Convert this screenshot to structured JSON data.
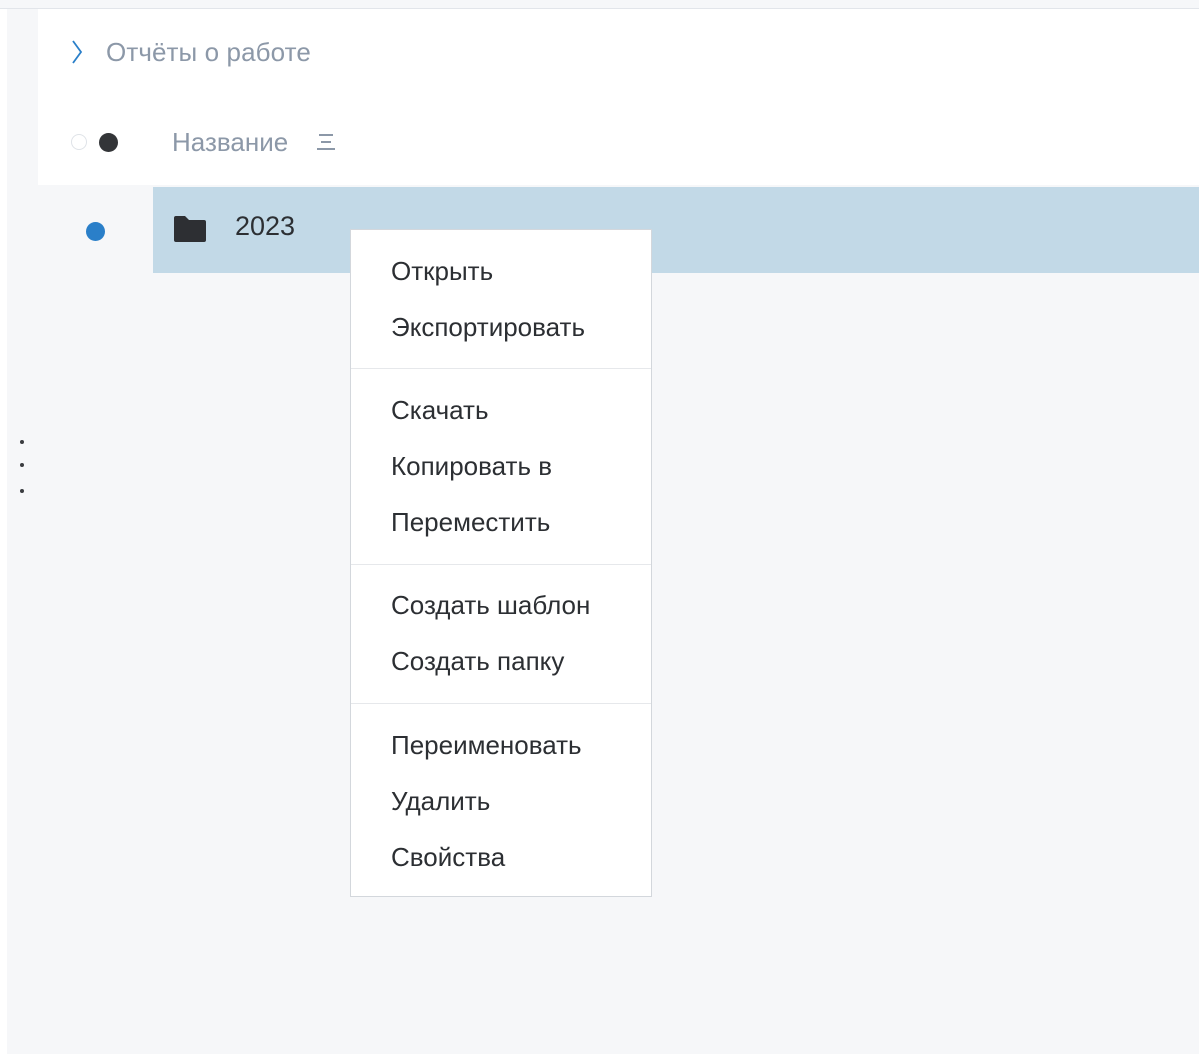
{
  "breadcrumb": {
    "icon": "chevron-right-icon",
    "label": "Отчёты о работе"
  },
  "table_header": {
    "select_all_icons": [
      "empty-circle-icon",
      "filled-circle-icon"
    ],
    "name_column": "Название",
    "sort_icon": "sort-lines-icon"
  },
  "rows": [
    {
      "name": "2023",
      "icon": "folder-icon",
      "selected": true
    }
  ],
  "context_menu": {
    "items": [
      "Открыть",
      "Экспортировать",
      "Скачать",
      "Копировать в",
      "Переместить",
      "Создать шаблон",
      "Создать папку",
      "Переименовать",
      "Удалить",
      "Свойства"
    ]
  },
  "colors": {
    "selected_row": "#c2d9e7",
    "selection_dot": "#2a7fc9",
    "muted_text": "#8c98a8",
    "body_text": "#2c2f33"
  }
}
